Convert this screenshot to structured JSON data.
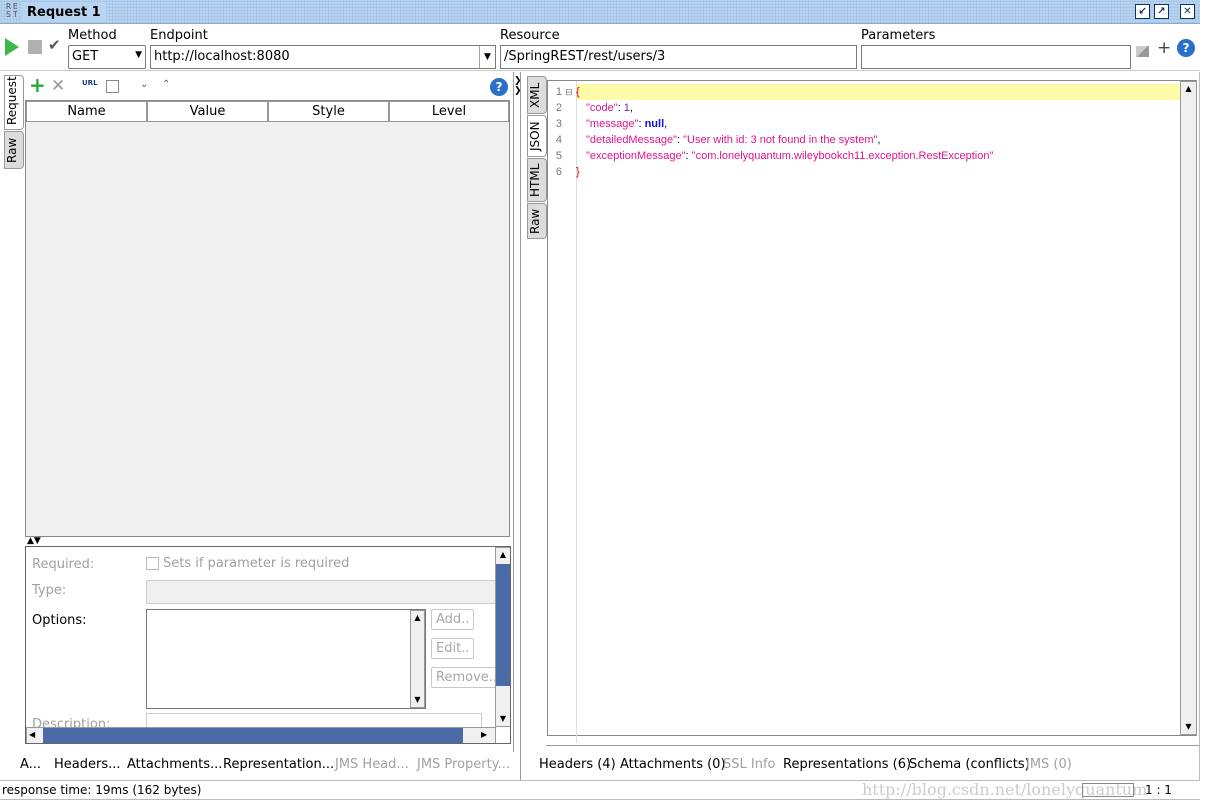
{
  "window": {
    "logo": "RE ST",
    "title": "Request 1",
    "colors": {
      "titlebar": "#b8d4f2",
      "accent": "#4a6aa8"
    }
  },
  "toolbar": {
    "method_label": "Method",
    "method_value": "GET",
    "endpoint_label": "Endpoint",
    "endpoint_value": "http://localhost:8080",
    "resource_label": "Resource",
    "resource_value": "/SpringREST/rest/users/3",
    "parameters_label": "Parameters",
    "parameters_value": ""
  },
  "left": {
    "tabs": [
      {
        "label": "Request",
        "selected": true
      },
      {
        "label": "Raw",
        "selected": false
      }
    ],
    "columns": [
      "Name",
      "Value",
      "Style",
      "Level"
    ],
    "detail": {
      "required_label": "Required:",
      "required_checkbox": "Sets if parameter is required",
      "type_label": "Type:",
      "options_label": "Options:",
      "add": "Add..",
      "edit": "Edit..",
      "remove": "Remove..",
      "description_label": "Description:"
    },
    "bottom_tabs": [
      {
        "label": "A...",
        "enabled": true
      },
      {
        "label": "Headers...",
        "enabled": true
      },
      {
        "label": "Attachments...",
        "enabled": true
      },
      {
        "label": "Representation...",
        "enabled": true
      },
      {
        "label": "JMS Head...",
        "enabled": false
      },
      {
        "label": "JMS Property...",
        "enabled": false
      }
    ]
  },
  "right": {
    "tabs": [
      {
        "label": "XML",
        "selected": false
      },
      {
        "label": "JSON",
        "selected": true
      },
      {
        "label": "HTML",
        "selected": false
      },
      {
        "label": "Raw",
        "selected": false
      }
    ],
    "lines": [
      {
        "n": "1",
        "text": "{"
      },
      {
        "n": "2",
        "key": "\"code\"",
        "value": "1"
      },
      {
        "n": "3",
        "key": "\"message\"",
        "value": "null"
      },
      {
        "n": "4",
        "key": "\"detailedMessage\"",
        "value": "\"User with id: 3 not found in the system\""
      },
      {
        "n": "5",
        "key": "\"exceptionMessage\"",
        "value": "\"com.lonelyquantum.wileybookch11.exception.RestException\""
      },
      {
        "n": "6",
        "text": "}"
      }
    ],
    "bottom_tabs": [
      {
        "label": "Headers (4)",
        "enabled": true
      },
      {
        "label": "Attachments (0)",
        "enabled": true
      },
      {
        "label": "SSL Info",
        "enabled": false
      },
      {
        "label": "Representations (6)",
        "enabled": true
      },
      {
        "label": "Schema (conflicts)",
        "enabled": true
      },
      {
        "label": "JMS (0)",
        "enabled": false
      }
    ]
  },
  "status": {
    "response_time": "response time: 19ms (162 bytes)",
    "position": "1 : 1",
    "watermark": "http://blog.csdn.net/lonelyquantum"
  }
}
